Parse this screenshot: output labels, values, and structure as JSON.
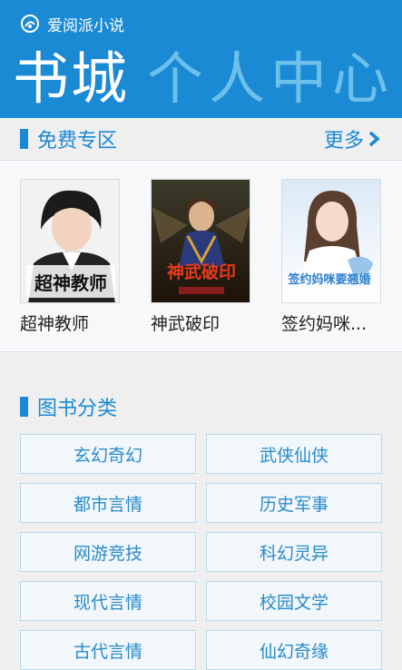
{
  "app": {
    "title": "爱阅派小说"
  },
  "pivot": {
    "active": "书城",
    "inactive": "个人中心"
  },
  "free_zone": {
    "title": "免费专区",
    "more": "更多",
    "books": [
      {
        "title": "超神教师",
        "cover_text": "超神教师"
      },
      {
        "title": "神武破印",
        "cover_text": "神武破印"
      },
      {
        "title": "签约妈咪...",
        "cover_text": "签约妈咪要翘婚"
      }
    ]
  },
  "categories": {
    "title": "图书分类",
    "items": [
      "玄幻奇幻",
      "武侠仙侠",
      "都市言情",
      "历史军事",
      "网游竞技",
      "科幻灵异",
      "现代言情",
      "校园文学",
      "古代言情",
      "仙幻奇缘"
    ]
  },
  "colors": {
    "primary": "#1a8ad4",
    "pivot_inactive": "#6cc0ea",
    "page_bg": "#efefef"
  }
}
